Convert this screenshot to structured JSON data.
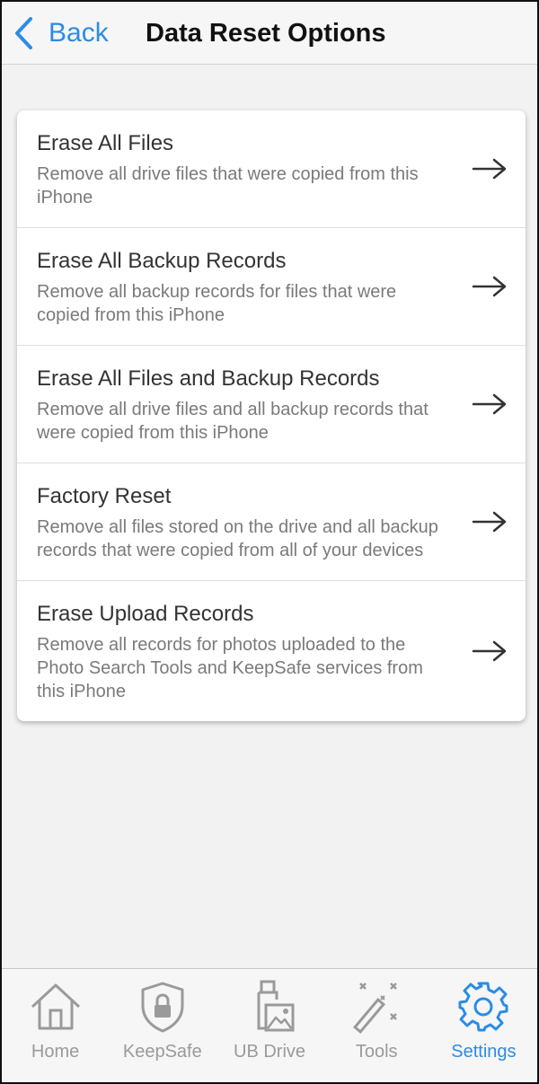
{
  "header": {
    "back_label": "Back",
    "title": "Data Reset Options"
  },
  "options": [
    {
      "title": "Erase All Files",
      "description": "Remove all drive files that were copied from this iPhone"
    },
    {
      "title": "Erase All Backup Records",
      "description": "Remove all backup records for files that were copied from this iPhone"
    },
    {
      "title": "Erase All Files and Backup Records",
      "description": "Remove all drive files and all backup records that were copied from this iPhone"
    },
    {
      "title": "Factory Reset",
      "description": "Remove all files stored on the drive and all backup records that were copied from all of your devices"
    },
    {
      "title": "Erase Upload Records",
      "description": "Remove all records for photos uploaded to the Photo Search Tools and KeepSafe services from this iPhone"
    }
  ],
  "tabs": [
    {
      "label": "Home",
      "icon": "home-icon",
      "active": false
    },
    {
      "label": "KeepSafe",
      "icon": "shield-lock-icon",
      "active": false
    },
    {
      "label": "UB Drive",
      "icon": "usb-drive-icon",
      "active": false
    },
    {
      "label": "Tools",
      "icon": "magic-wand-icon",
      "active": false
    },
    {
      "label": "Settings",
      "icon": "gear-icon",
      "active": true
    }
  ],
  "colors": {
    "accent": "#2b8ce6",
    "inactive": "#9a9a9a"
  }
}
